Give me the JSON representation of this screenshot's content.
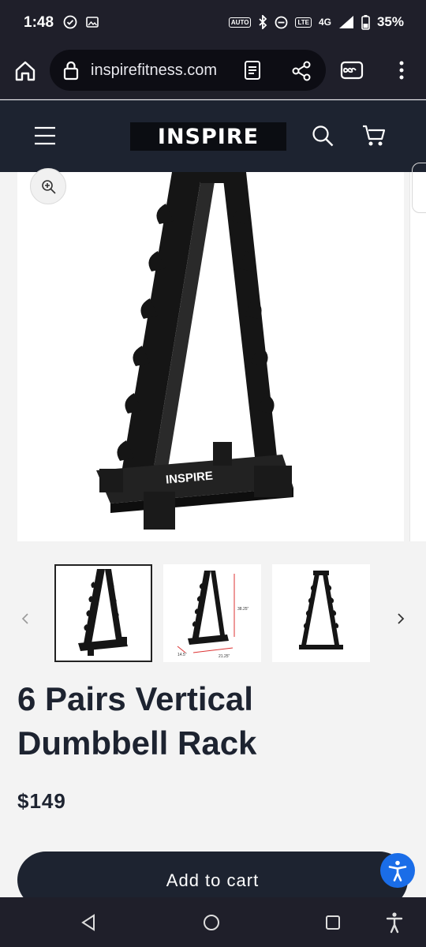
{
  "status": {
    "time": "1:48",
    "battery": "35%",
    "network": "4G",
    "auto_badge": "AUTO",
    "lte_badge": "LTE"
  },
  "browser": {
    "url": "inspirefitness.com"
  },
  "site": {
    "logo": "INSPIRE"
  },
  "product": {
    "title": "6 Pairs Vertical Dumbbell Rack",
    "price": "$149",
    "add_to_cart": "Add to cart",
    "image_brand": "INSPIRE",
    "dims": {
      "height": "38.25\"",
      "width": "21.25\"",
      "depth": "14.5\""
    }
  },
  "colors": {
    "dark_bar": "#1f1f2a",
    "header": "#1d2330",
    "accent_blue": "#1a6de8"
  }
}
